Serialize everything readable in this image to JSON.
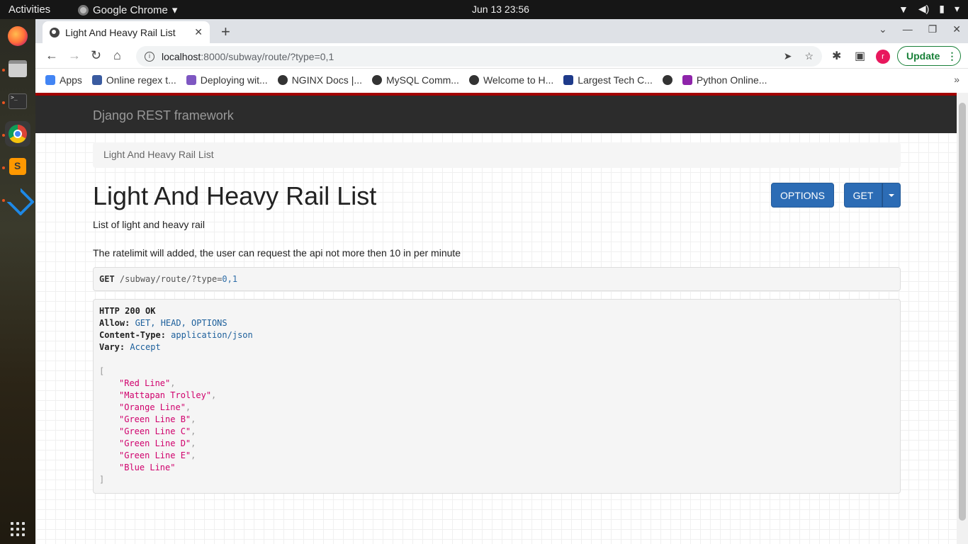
{
  "topbar": {
    "activities": "Activities",
    "app_name": "Google Chrome",
    "clock": "Jun 13  23:56"
  },
  "browser": {
    "tab_title": "Light And Heavy Rail List",
    "url_host": "localhost",
    "url_path": ":8000/subway/route/?type=0,1",
    "avatar_letter": "r",
    "update_label": "Update",
    "bookmarks": [
      {
        "label": "Apps",
        "color": "#4285f4"
      },
      {
        "label": "Online regex t...",
        "color": "#3a5ba0"
      },
      {
        "label": "Deploying wit...",
        "color": "#7e57c2"
      },
      {
        "label": "NGINX Docs |...",
        "color": "#333333"
      },
      {
        "label": "MySQL Comm...",
        "color": "#333333"
      },
      {
        "label": "Welcome to H...",
        "color": "#333333"
      },
      {
        "label": "Largest Tech C...",
        "color": "#1e3a8a"
      },
      {
        "label": "",
        "color": "#333333"
      },
      {
        "label": "Python Online...",
        "color": "#8e24aa"
      }
    ]
  },
  "page": {
    "brand": "Django REST framework",
    "breadcrumb": "Light And Heavy Rail List",
    "title": "Light And Heavy Rail List",
    "options_label": "OPTIONS",
    "get_label": "GET",
    "description_1": "List of light and heavy rail",
    "description_2": "The ratelimit will added, the user can request the api not more then 10 in per minute",
    "request": {
      "method": "GET",
      "path": "/subway/route/?type=0,1"
    },
    "response": {
      "status": "HTTP 200 OK",
      "headers": [
        {
          "key": "Allow:",
          "value": "GET, HEAD, OPTIONS"
        },
        {
          "key": "Content-Type:",
          "value": "application/json"
        },
        {
          "key": "Vary:",
          "value": "Accept"
        }
      ],
      "items": [
        "\"Red Line\"",
        "\"Mattapan Trolley\"",
        "\"Orange Line\"",
        "\"Green Line B\"",
        "\"Green Line C\"",
        "\"Green Line D\"",
        "\"Green Line E\"",
        "\"Blue Line\""
      ]
    }
  }
}
